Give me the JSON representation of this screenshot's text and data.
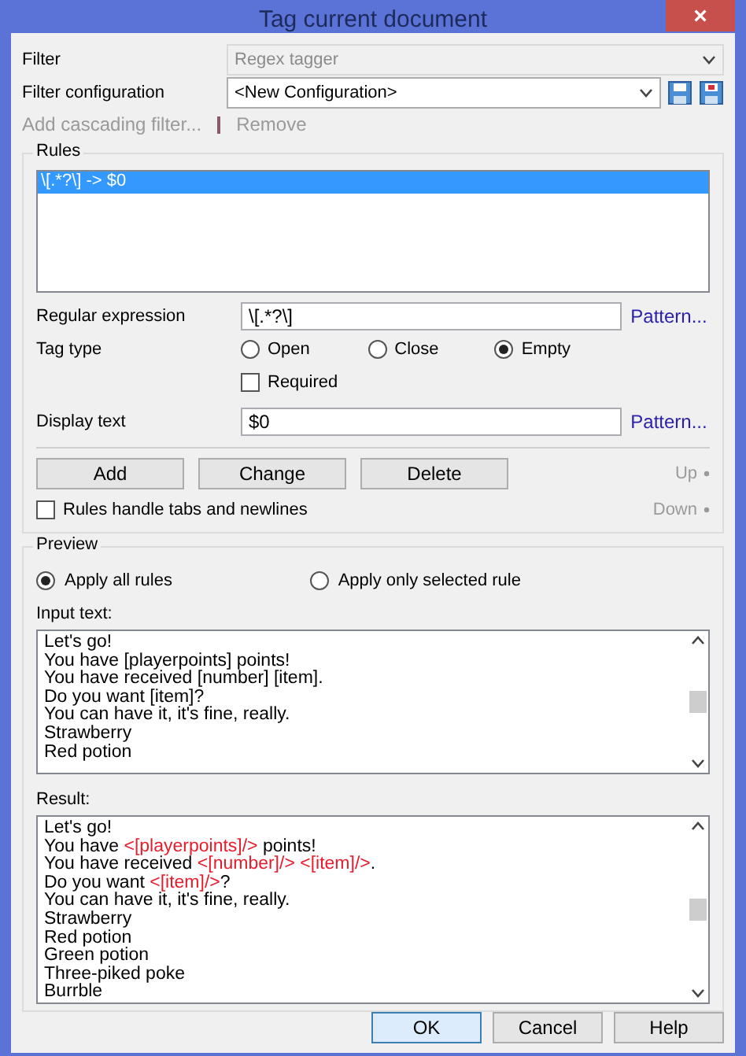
{
  "window": {
    "title": "Tag current document",
    "close": "×"
  },
  "filter": {
    "label": "Filter",
    "value": "Regex tagger",
    "disabled": true
  },
  "filter_configuration": {
    "label": "Filter configuration",
    "value": "<New Configuration>"
  },
  "cascade_links": [
    {
      "label": "Add cascading filter...",
      "disabled": true
    },
    {
      "label": "Remove",
      "disabled": true
    }
  ],
  "rules": {
    "title": "Rules",
    "items": [
      {
        "label": "\\[.*?\\] -> $0",
        "selected": true
      }
    ]
  },
  "regular_expression": {
    "label": "Regular expression",
    "value": "\\[.*?\\]",
    "link": "Pattern..."
  },
  "tag_type": {
    "label": "Tag type",
    "options": [
      {
        "label": "Open",
        "selected": false
      },
      {
        "label": "Close",
        "selected": false
      },
      {
        "label": "Empty",
        "selected": true
      }
    ]
  },
  "required": {
    "label": "Required",
    "checked": false
  },
  "display_text": {
    "label": "Display text",
    "value": "$0",
    "link": "Pattern..."
  },
  "rule_buttons": [
    "Add",
    "Change",
    "Delete"
  ],
  "move_links": [
    {
      "label": "Up",
      "disabled": true
    },
    {
      "label": "Down",
      "disabled": true
    }
  ],
  "handle_tabs": {
    "label": "Rules handle tabs and newlines",
    "checked": false
  },
  "preview": {
    "title": "Preview",
    "modes": [
      {
        "label": "Apply all rules",
        "selected": true
      },
      {
        "label": "Apply only selected rule",
        "selected": false
      }
    ],
    "input_label": "Input text:",
    "input_lines": [
      "Let's go!",
      "You have [playerpoints] points!",
      "You have received [number] [item].",
      "Do you want [item]?",
      "You can have it, it's fine, really.",
      "Strawberry",
      "Red potion"
    ],
    "result_label": "Result:",
    "result_lines": [
      [
        {
          "kind": "plain",
          "text": "Let's go!"
        }
      ],
      [
        {
          "kind": "plain",
          "text": "You have "
        },
        {
          "kind": "tag",
          "text": "<[playerpoints]/>"
        },
        {
          "kind": "plain",
          "text": " points!"
        }
      ],
      [
        {
          "kind": "plain",
          "text": "You have received "
        },
        {
          "kind": "tag",
          "text": "<[number]/> <[item]/>"
        },
        {
          "kind": "plain",
          "text": "."
        }
      ],
      [
        {
          "kind": "plain",
          "text": "Do you want "
        },
        {
          "kind": "tag",
          "text": "<[item]/>"
        },
        {
          "kind": "plain",
          "text": "?"
        }
      ],
      [
        {
          "kind": "plain",
          "text": "You can have it, it's fine, really."
        }
      ],
      [
        {
          "kind": "plain",
          "text": "Strawberry"
        }
      ],
      [
        {
          "kind": "plain",
          "text": "Red potion"
        }
      ],
      [
        {
          "kind": "plain",
          "text": "Green potion"
        }
      ],
      [
        {
          "kind": "plain",
          "text": "Three-piked poke"
        }
      ],
      [
        {
          "kind": "plain",
          "text": "Burrble"
        }
      ]
    ]
  },
  "dialog_buttons": [
    {
      "label": "OK",
      "default": true
    },
    {
      "label": "Cancel",
      "default": false
    },
    {
      "label": "Help",
      "default": false
    }
  ]
}
